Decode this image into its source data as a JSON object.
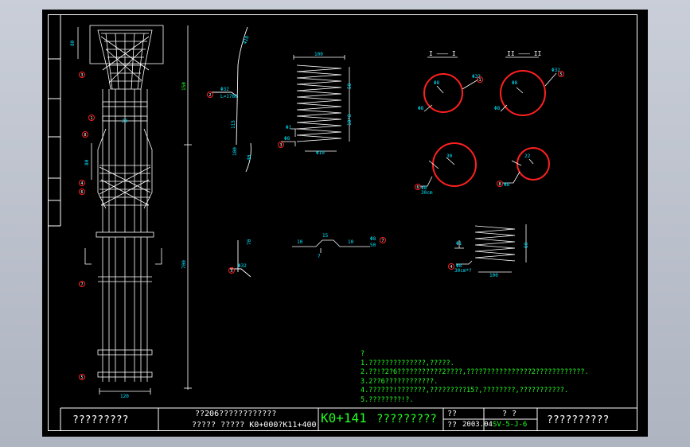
{
  "title_block": {
    "left_cell": "?????????",
    "project_line1": "??206????????????",
    "project_line2": "?????   ?????    K0+000?K11+400",
    "station": "K0+141",
    "drawing_title": "?????????",
    "label_a": "??",
    "label_b": "??",
    "date": "2003.04",
    "sheet_label": "? ?",
    "sheet_no": "SV-5-J-6",
    "right_cell": "??????????"
  },
  "notes": {
    "heading": "?",
    "lines": [
      "1.??????????????,?????.",
      "2.??!?2?6???????????2????,????7???????????2????????????.",
      "3.2??6????????????.",
      "4.??????!???????,?????????15?,????????,???????????.",
      "5.????????!?."
    ]
  },
  "sections": {
    "section_1": "I ——— I",
    "section_2": "II ——— II"
  },
  "markers": [
    "1",
    "2",
    "3",
    "4",
    "5",
    "6",
    "7",
    "8"
  ],
  "colors": {
    "background": "#000000",
    "lines": "#ffffff",
    "cyan": "#00e5ff",
    "red": "#ff2020",
    "green": "#22ff22"
  }
}
